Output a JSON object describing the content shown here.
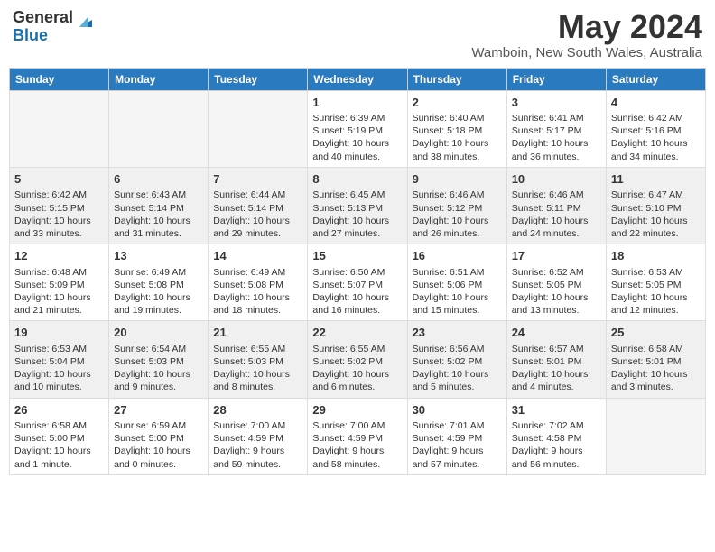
{
  "logo": {
    "general": "General",
    "blue": "Blue"
  },
  "title": "May 2024",
  "location": "Wamboin, New South Wales, Australia",
  "days_of_week": [
    "Sunday",
    "Monday",
    "Tuesday",
    "Wednesday",
    "Thursday",
    "Friday",
    "Saturday"
  ],
  "weeks": [
    {
      "shaded": false,
      "days": [
        {
          "num": "",
          "empty": true,
          "info": ""
        },
        {
          "num": "",
          "empty": true,
          "info": ""
        },
        {
          "num": "",
          "empty": true,
          "info": ""
        },
        {
          "num": "1",
          "empty": false,
          "info": "Sunrise: 6:39 AM\nSunset: 5:19 PM\nDaylight: 10 hours\nand 40 minutes."
        },
        {
          "num": "2",
          "empty": false,
          "info": "Sunrise: 6:40 AM\nSunset: 5:18 PM\nDaylight: 10 hours\nand 38 minutes."
        },
        {
          "num": "3",
          "empty": false,
          "info": "Sunrise: 6:41 AM\nSunset: 5:17 PM\nDaylight: 10 hours\nand 36 minutes."
        },
        {
          "num": "4",
          "empty": false,
          "info": "Sunrise: 6:42 AM\nSunset: 5:16 PM\nDaylight: 10 hours\nand 34 minutes."
        }
      ]
    },
    {
      "shaded": true,
      "days": [
        {
          "num": "5",
          "empty": false,
          "info": "Sunrise: 6:42 AM\nSunset: 5:15 PM\nDaylight: 10 hours\nand 33 minutes."
        },
        {
          "num": "6",
          "empty": false,
          "info": "Sunrise: 6:43 AM\nSunset: 5:14 PM\nDaylight: 10 hours\nand 31 minutes."
        },
        {
          "num": "7",
          "empty": false,
          "info": "Sunrise: 6:44 AM\nSunset: 5:14 PM\nDaylight: 10 hours\nand 29 minutes."
        },
        {
          "num": "8",
          "empty": false,
          "info": "Sunrise: 6:45 AM\nSunset: 5:13 PM\nDaylight: 10 hours\nand 27 minutes."
        },
        {
          "num": "9",
          "empty": false,
          "info": "Sunrise: 6:46 AM\nSunset: 5:12 PM\nDaylight: 10 hours\nand 26 minutes."
        },
        {
          "num": "10",
          "empty": false,
          "info": "Sunrise: 6:46 AM\nSunset: 5:11 PM\nDaylight: 10 hours\nand 24 minutes."
        },
        {
          "num": "11",
          "empty": false,
          "info": "Sunrise: 6:47 AM\nSunset: 5:10 PM\nDaylight: 10 hours\nand 22 minutes."
        }
      ]
    },
    {
      "shaded": false,
      "days": [
        {
          "num": "12",
          "empty": false,
          "info": "Sunrise: 6:48 AM\nSunset: 5:09 PM\nDaylight: 10 hours\nand 21 minutes."
        },
        {
          "num": "13",
          "empty": false,
          "info": "Sunrise: 6:49 AM\nSunset: 5:08 PM\nDaylight: 10 hours\nand 19 minutes."
        },
        {
          "num": "14",
          "empty": false,
          "info": "Sunrise: 6:49 AM\nSunset: 5:08 PM\nDaylight: 10 hours\nand 18 minutes."
        },
        {
          "num": "15",
          "empty": false,
          "info": "Sunrise: 6:50 AM\nSunset: 5:07 PM\nDaylight: 10 hours\nand 16 minutes."
        },
        {
          "num": "16",
          "empty": false,
          "info": "Sunrise: 6:51 AM\nSunset: 5:06 PM\nDaylight: 10 hours\nand 15 minutes."
        },
        {
          "num": "17",
          "empty": false,
          "info": "Sunrise: 6:52 AM\nSunset: 5:05 PM\nDaylight: 10 hours\nand 13 minutes."
        },
        {
          "num": "18",
          "empty": false,
          "info": "Sunrise: 6:53 AM\nSunset: 5:05 PM\nDaylight: 10 hours\nand 12 minutes."
        }
      ]
    },
    {
      "shaded": true,
      "days": [
        {
          "num": "19",
          "empty": false,
          "info": "Sunrise: 6:53 AM\nSunset: 5:04 PM\nDaylight: 10 hours\nand 10 minutes."
        },
        {
          "num": "20",
          "empty": false,
          "info": "Sunrise: 6:54 AM\nSunset: 5:03 PM\nDaylight: 10 hours\nand 9 minutes."
        },
        {
          "num": "21",
          "empty": false,
          "info": "Sunrise: 6:55 AM\nSunset: 5:03 PM\nDaylight: 10 hours\nand 8 minutes."
        },
        {
          "num": "22",
          "empty": false,
          "info": "Sunrise: 6:55 AM\nSunset: 5:02 PM\nDaylight: 10 hours\nand 6 minutes."
        },
        {
          "num": "23",
          "empty": false,
          "info": "Sunrise: 6:56 AM\nSunset: 5:02 PM\nDaylight: 10 hours\nand 5 minutes."
        },
        {
          "num": "24",
          "empty": false,
          "info": "Sunrise: 6:57 AM\nSunset: 5:01 PM\nDaylight: 10 hours\nand 4 minutes."
        },
        {
          "num": "25",
          "empty": false,
          "info": "Sunrise: 6:58 AM\nSunset: 5:01 PM\nDaylight: 10 hours\nand 3 minutes."
        }
      ]
    },
    {
      "shaded": false,
      "days": [
        {
          "num": "26",
          "empty": false,
          "info": "Sunrise: 6:58 AM\nSunset: 5:00 PM\nDaylight: 10 hours\nand 1 minute."
        },
        {
          "num": "27",
          "empty": false,
          "info": "Sunrise: 6:59 AM\nSunset: 5:00 PM\nDaylight: 10 hours\nand 0 minutes."
        },
        {
          "num": "28",
          "empty": false,
          "info": "Sunrise: 7:00 AM\nSunset: 4:59 PM\nDaylight: 9 hours\nand 59 minutes."
        },
        {
          "num": "29",
          "empty": false,
          "info": "Sunrise: 7:00 AM\nSunset: 4:59 PM\nDaylight: 9 hours\nand 58 minutes."
        },
        {
          "num": "30",
          "empty": false,
          "info": "Sunrise: 7:01 AM\nSunset: 4:59 PM\nDaylight: 9 hours\nand 57 minutes."
        },
        {
          "num": "31",
          "empty": false,
          "info": "Sunrise: 7:02 AM\nSunset: 4:58 PM\nDaylight: 9 hours\nand 56 minutes."
        },
        {
          "num": "",
          "empty": true,
          "info": ""
        }
      ]
    }
  ]
}
